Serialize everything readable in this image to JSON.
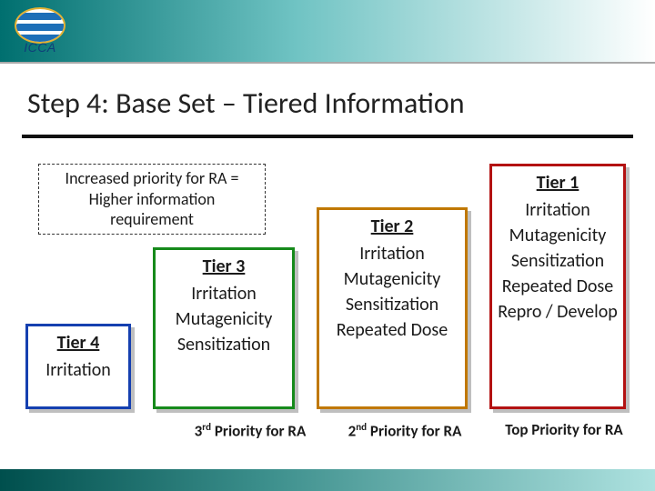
{
  "logo": {
    "letters": "ICCA"
  },
  "title": "Step 4: Base Set – Tiered Information",
  "note": "Increased priority for RA = Higher information requirement",
  "tiers": {
    "t1": {
      "head": "Tier 1",
      "entries": [
        "Irritation",
        "Mutagenicity",
        "Sensitization",
        "Repeated Dose",
        "Repro / Develop"
      ]
    },
    "t2": {
      "head": "Tier 2",
      "entries": [
        "Irritation",
        "Mutagenicity",
        "Sensitization",
        "Repeated Dose"
      ]
    },
    "t3": {
      "head": "Tier 3",
      "entries": [
        "Irritation",
        "Mutagenicity",
        "Sensitization"
      ]
    },
    "t4": {
      "head": "Tier 4",
      "entries": [
        "Irritation"
      ]
    }
  },
  "captions": {
    "c3": {
      "ord": "3",
      "sup": "rd",
      "rest": " Priority for RA"
    },
    "c2": {
      "ord": "2",
      "sup": "nd",
      "rest": " Priority for RA"
    },
    "c1": "Top Priority for RA"
  }
}
